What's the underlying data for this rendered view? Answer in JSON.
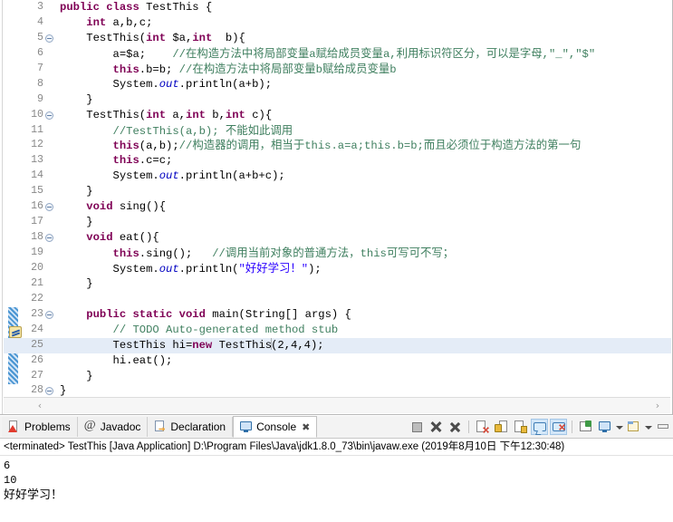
{
  "editor": {
    "name": "java-source-editor",
    "first_visible_line": 3,
    "selected_line": 25,
    "changed_lines": "23-27",
    "lines": [
      {
        "num": "3",
        "fold": false,
        "html": "<span class=\"kw\">public class</span> <span class=\"plain\">TestThis {</span>"
      },
      {
        "num": "4",
        "fold": false,
        "html": "<span class=\"plain\">    </span><span class=\"kw\">int</span> <span class=\"plain\">a,b,c;</span>"
      },
      {
        "num": "5",
        "fold": true,
        "html": "<span class=\"plain\">    TestThis(</span><span class=\"kw\">int</span> <span class=\"plain\">$a,</span><span class=\"kw\">int</span> <span class=\"plain\"> b){</span>"
      },
      {
        "num": "6",
        "fold": false,
        "html": "<span class=\"plain\">        a=$a;    </span><span class=\"cmt\">//<span class=\"cn\">在构造方法中将局部变量</span>a<span class=\"cn\">赋给成员变量</span>a,<span class=\"cn\">利用标识符区分，可以是字母</span>,\"_\",\"$\"</span>"
      },
      {
        "num": "7",
        "fold": false,
        "html": "<span class=\"plain\">        </span><span class=\"kw\">this</span><span class=\"plain\">.b=b; </span><span class=\"cmt\">//<span class=\"cn\">在构造方法中将局部变量</span>b<span class=\"cn\">赋给成员变量</span>b</span>"
      },
      {
        "num": "8",
        "fold": false,
        "html": "<span class=\"plain\">        System.</span><span class=\"fld\">out</span><span class=\"plain\">.println(a+b);</span>"
      },
      {
        "num": "9",
        "fold": false,
        "html": "<span class=\"plain\">    }</span>"
      },
      {
        "num": "10",
        "fold": true,
        "html": "<span class=\"plain\">    TestThis(</span><span class=\"kw\">int</span> <span class=\"plain\">a,</span><span class=\"kw\">int</span> <span class=\"plain\">b,</span><span class=\"kw\">int</span> <span class=\"plain\">c){</span>"
      },
      {
        "num": "11",
        "fold": false,
        "html": "<span class=\"plain\">        </span><span class=\"cmt\">//TestThis(a,b); <span class=\"cn\">不能如此调用</span></span>"
      },
      {
        "num": "12",
        "fold": false,
        "html": "<span class=\"plain\">        </span><span class=\"kw\">this</span><span class=\"plain\">(a,b);</span><span class=\"cmt\">//<span class=\"cn\">构造器的调用，相当于</span>this.a=a;this.b=b;<span class=\"cn\">而且必须位于构造方法的第一句</span></span>"
      },
      {
        "num": "13",
        "fold": false,
        "html": "<span class=\"plain\">        </span><span class=\"kw\">this</span><span class=\"plain\">.c=c;</span>"
      },
      {
        "num": "14",
        "fold": false,
        "html": "<span class=\"plain\">        System.</span><span class=\"fld\">out</span><span class=\"plain\">.println(a+b+c);</span>"
      },
      {
        "num": "15",
        "fold": false,
        "html": "<span class=\"plain\">    }</span>"
      },
      {
        "num": "16",
        "fold": true,
        "html": "<span class=\"plain\">    </span><span class=\"kw\">void</span> <span class=\"plain\">sing(){</span>"
      },
      {
        "num": "17",
        "fold": false,
        "html": "<span class=\"plain\">    }</span>"
      },
      {
        "num": "18",
        "fold": true,
        "html": "<span class=\"plain\">    </span><span class=\"kw\">void</span> <span class=\"plain\">eat(){</span>"
      },
      {
        "num": "19",
        "fold": false,
        "html": "<span class=\"plain\">        </span><span class=\"kw\">this</span><span class=\"plain\">.sing();   </span><span class=\"cmt\">//<span class=\"cn\">调用当前对象的普通方法，</span>this<span class=\"cn\">可写可不写；</span></span>"
      },
      {
        "num": "20",
        "fold": false,
        "html": "<span class=\"plain\">        System.</span><span class=\"fld\">out</span><span class=\"plain\">.println(</span><span class=\"str\">\"<span class=\"cn\">好好学习！</span>\"</span><span class=\"plain\">);</span>"
      },
      {
        "num": "21",
        "fold": false,
        "html": "<span class=\"plain\">    }</span>"
      },
      {
        "num": "22",
        "fold": false,
        "html": ""
      },
      {
        "num": "23",
        "fold": true,
        "html": "<span class=\"plain\">    </span><span class=\"kw\">public static void</span> <span class=\"plain\">main(String[] args) {</span>"
      },
      {
        "num": "24",
        "fold": false,
        "html": "<span class=\"plain\">        </span><span class=\"cmt\">// TODO Auto-generated method stub</span>"
      },
      {
        "num": "25",
        "fold": false,
        "html": "<span class=\"plain\">        TestThis hi=</span><span class=\"kw\">new</span> <span class=\"plain\">TestThis</span><span class=\"caret\"></span><span class=\"plain\">(2,4,4);</span>"
      },
      {
        "num": "26",
        "fold": false,
        "html": "<span class=\"plain\">        hi.eat();</span>"
      },
      {
        "num": "27",
        "fold": false,
        "html": "<span class=\"plain\">    }</span>"
      },
      {
        "num": "28",
        "fold": true,
        "html": "<span class=\"plain\">}</span>"
      }
    ],
    "hscroll": {
      "left_arrow": "‹",
      "right_arrow": "›"
    }
  },
  "bottom_view": {
    "tabs": [
      {
        "label": "Problems",
        "icon": "problems-icon",
        "active": false,
        "closable": false
      },
      {
        "label": "Javadoc",
        "icon": "javadoc-icon",
        "active": false,
        "closable": false
      },
      {
        "label": "Declaration",
        "icon": "declaration-icon",
        "active": false,
        "closable": false
      },
      {
        "label": "Console",
        "icon": "console-icon",
        "active": true,
        "closable": true,
        "close_glyph": "✖"
      }
    ],
    "toolbar": [
      {
        "name": "terminate-button",
        "glyph": "g-stop",
        "toggled": false
      },
      {
        "name": "remove-launch-button",
        "glyph": "g-x1",
        "toggled": false
      },
      {
        "name": "remove-all-terminated-button",
        "glyph": "g-x2",
        "toggled": false
      },
      {
        "name": "clear-console-button",
        "glyph": "g-clear",
        "toggled": false
      },
      {
        "name": "scroll-lock-button",
        "glyph": "g-lock",
        "toggled": false
      },
      {
        "name": "word-wrap-button",
        "glyph": "g-scroll",
        "toggled": false
      },
      {
        "name": "show-console-on-output-button",
        "glyph": "g-bubble",
        "toggled": true
      },
      {
        "name": "show-console-on-error-button",
        "glyph": "g-bubblex",
        "toggled": true
      },
      {
        "name": "pin-console-button",
        "glyph": "g-pin",
        "toggled": false
      },
      {
        "name": "display-selected-console-button",
        "glyph": "g-newcons",
        "toggled": false
      },
      {
        "name": "open-console-button",
        "glyph": "g-open",
        "toggled": false
      },
      {
        "name": "minimize-view-button",
        "glyph": "g-min",
        "toggled": false
      }
    ],
    "launch_status": "<terminated> TestThis [Java Application] D:\\Program Files\\Java\\jdk1.8.0_73\\bin\\javaw.exe (2019年8月10日 下午12:30:48)",
    "console_output_lines": [
      "6",
      "10",
      "好好学习！"
    ]
  },
  "colors": {
    "keyword": "#7F0055",
    "comment": "#3F7F5F",
    "string": "#2A00FF",
    "field": "#0000C0",
    "selection_line": "#E4ECF7",
    "change_bar": "#3F8FD0",
    "toolbar_toggled": "#D2E6F8"
  }
}
